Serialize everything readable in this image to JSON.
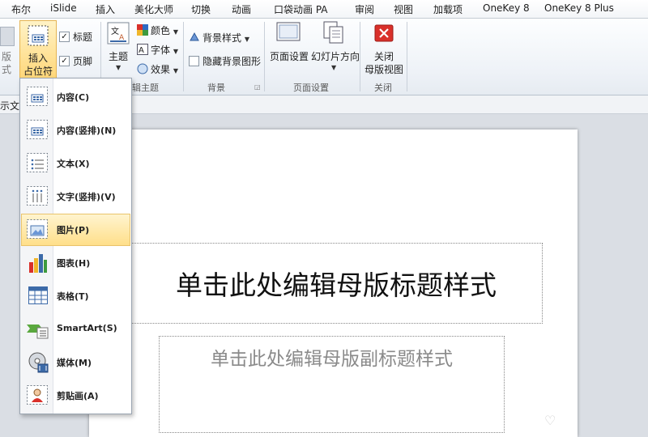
{
  "tabs": [
    "布尔",
    "iSlide",
    "插入",
    "美化大师",
    "切换",
    "动画",
    "口袋动画 PA",
    "审阅",
    "视图",
    "加载项",
    "OneKey 8",
    "OneKey 8 Plus"
  ],
  "ribbon": {
    "left_partial_1": "版",
    "left_partial_2": "式",
    "insert_placeholder_line1": "插入",
    "insert_placeholder_line2": "占位符",
    "title_checkbox": "标题",
    "footer_checkbox": "页脚",
    "theme": "主题",
    "colors": "颜色",
    "fonts": "字体",
    "effects": "效果",
    "edit_theme_group": "辑主题",
    "background_styles": "背景样式",
    "hide_background": "隐藏背景图形",
    "background_group": "背景",
    "page_setup": "页面设置",
    "slide_orientation": "幻灯片方向",
    "page_setup_group": "页面设置",
    "close_line1": "关闭",
    "close_line2": "母版视图",
    "close_group": "关闭"
  },
  "strip": {
    "partial": "示文"
  },
  "menu": [
    "内容(C)",
    "内容(竖排)(N)",
    "文本(X)",
    "文字(竖排)(V)",
    "图片(P)",
    "图表(H)",
    "表格(T)",
    "SmartArt(S)",
    "媒体(M)",
    "剪贴画(A)"
  ],
  "slide": {
    "title_placeholder": "单击此处编辑母版标题样式",
    "subtitle_placeholder": "单击此处编辑母版副标题样式"
  },
  "colors": {
    "accent_highlight": "#ffd77a",
    "close_red": "#d9302a"
  }
}
